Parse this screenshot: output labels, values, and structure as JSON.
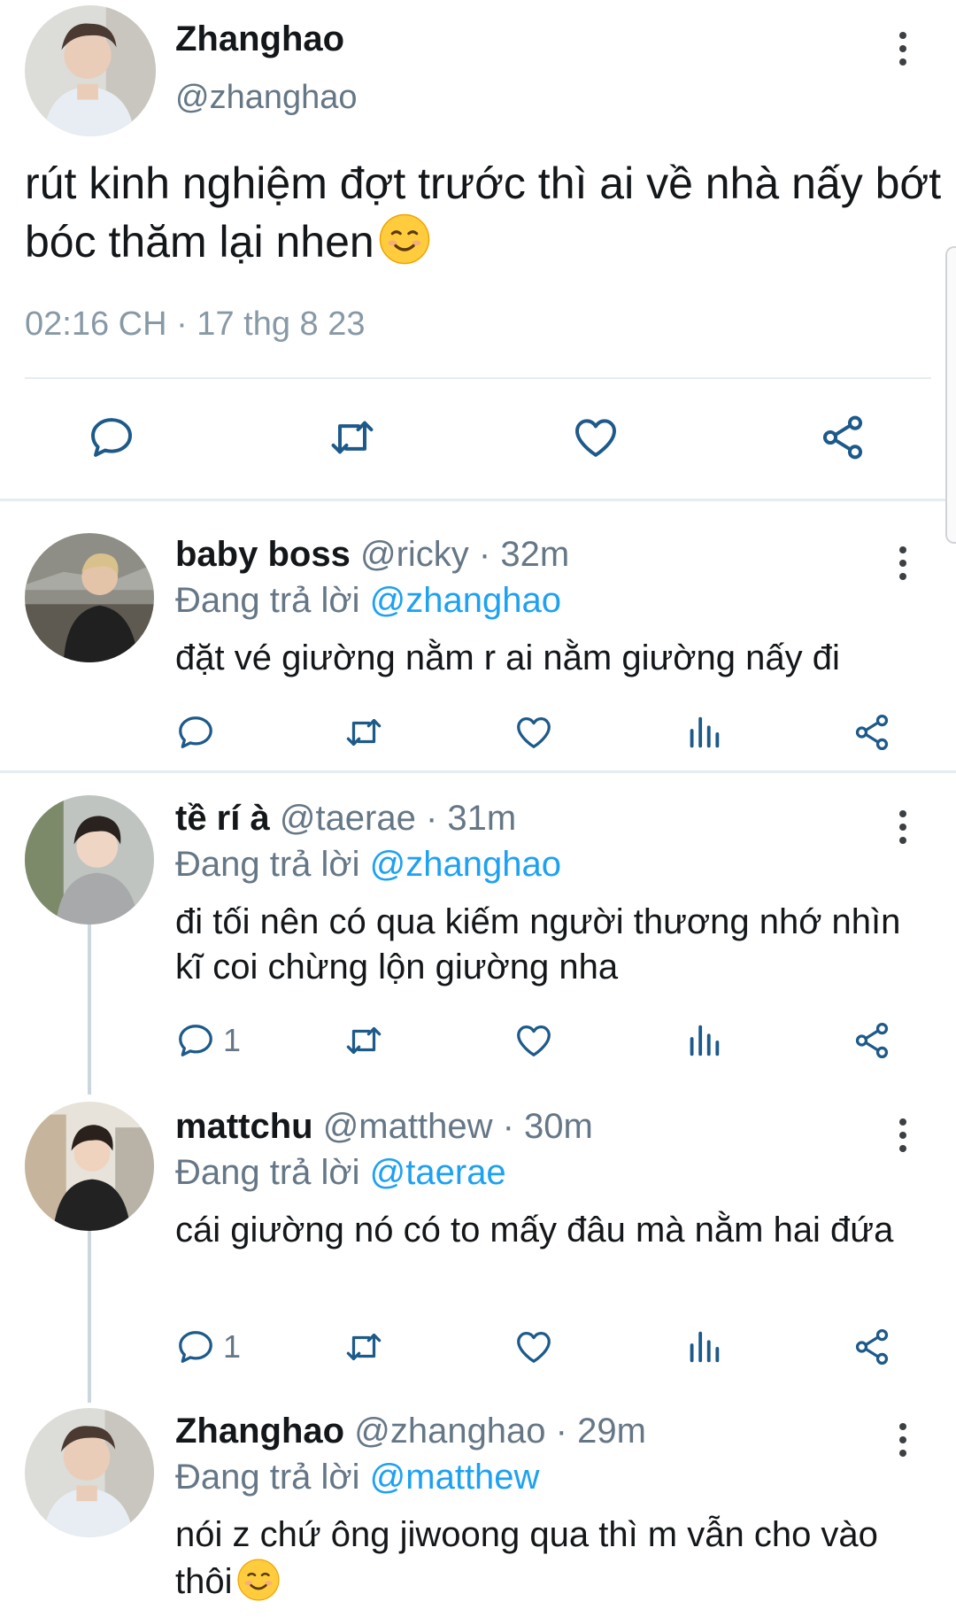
{
  "main_tweet": {
    "name": "Zhanghao",
    "handle": "@zhanghao",
    "text": "rút kinh nghiệm đợt trước thì ai về nhà nấy bớt bóc thăm lại nhen",
    "emoji": "smiling-face-icon",
    "timestamp": "02:16 CH · 17 thg 8 23",
    "actions": [
      "reply-icon",
      "retweet-icon",
      "like-icon",
      "share-icon"
    ]
  },
  "replies": [
    {
      "name": "baby boss",
      "meta": "@ricky · 32m",
      "replying_prefix": "Đang trả lời ",
      "replying_to": "@zhanghao",
      "text": "đặt vé giường nằm r ai nằm giường nấy đi",
      "reply_count": ""
    },
    {
      "name": "tề rí à",
      "meta": "@taerae · 31m",
      "replying_prefix": "Đang trả lời ",
      "replying_to": "@zhanghao",
      "text": "đi tối nên có qua kiếm người thương nhớ nhìn kĩ coi chừng lộn giường nha",
      "reply_count": "1"
    },
    {
      "name": "mattchu",
      "meta": "@matthew · 30m",
      "replying_prefix": "Đang trả lời ",
      "replying_to": "@taerae",
      "text": "cái giường nó có to mấy đâu mà nằm hai đứa",
      "reply_count": "1"
    },
    {
      "name": "Zhanghao",
      "meta": "@zhanghao · 29m",
      "replying_prefix": "Đang trả lời ",
      "replying_to": "@matthew",
      "text": "nói z chứ ông jiwoong qua thì m vẫn cho vào thôi",
      "emoji": "smiling-face-icon",
      "reply_count": ""
    }
  ],
  "colors": {
    "text": "#14171a",
    "secondary": "#657786",
    "accent": "#1da1f2",
    "icon": "#1d5a8a",
    "divider": "#e6ecf0"
  }
}
